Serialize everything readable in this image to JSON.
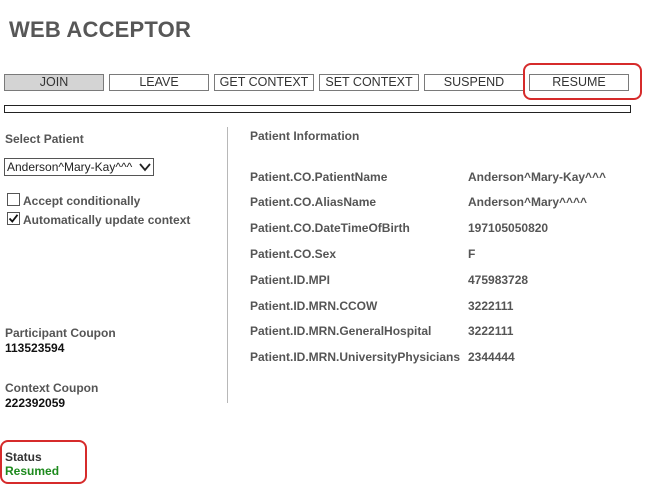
{
  "app": {
    "title": "WEB ACCEPTOR"
  },
  "toolbar": {
    "buttons": [
      {
        "label": "JOIN",
        "active": true
      },
      {
        "label": "LEAVE"
      },
      {
        "label": "GET CONTEXT"
      },
      {
        "label": "SET CONTEXT"
      },
      {
        "label": "SUSPEND"
      },
      {
        "label": "RESUME",
        "highlighted": true
      }
    ]
  },
  "left": {
    "select_patient_label": "Select Patient",
    "patient_select_value": "Anderson^Mary-Kay^^^",
    "accept_conditionally": {
      "label": "Accept conditionally",
      "checked": false
    },
    "auto_update": {
      "label": "Automatically update context",
      "checked": true
    },
    "participant_coupon": {
      "label": "Participant Coupon",
      "value": "113523594"
    },
    "context_coupon": {
      "label": "Context Coupon",
      "value": "222392059"
    },
    "status": {
      "label": "Status",
      "value": "Resumed",
      "color": "#1d8a1d"
    }
  },
  "patient_info": {
    "heading": "Patient Information",
    "fields": [
      {
        "label": "Patient.CO.PatientName",
        "value": "Anderson^Mary-Kay^^^"
      },
      {
        "label": "Patient.CO.AliasName",
        "value": "Anderson^Mary^^^^"
      },
      {
        "label": "Patient.CO.DateTimeOfBirth",
        "value": "197105050820"
      },
      {
        "label": "Patient.CO.Sex",
        "value": "F"
      },
      {
        "label": "Patient.ID.MPI",
        "value": "475983728"
      },
      {
        "label": "Patient.ID.MRN.CCOW",
        "value": "3222111"
      },
      {
        "label": "Patient.ID.MRN.GeneralHospital",
        "value": "3222111"
      },
      {
        "label": "Patient.ID.MRN.UniversityPhysicians",
        "value": "2344444"
      }
    ]
  },
  "colors": {
    "highlight": "#d62b2b",
    "status": "#1d8a1d"
  }
}
